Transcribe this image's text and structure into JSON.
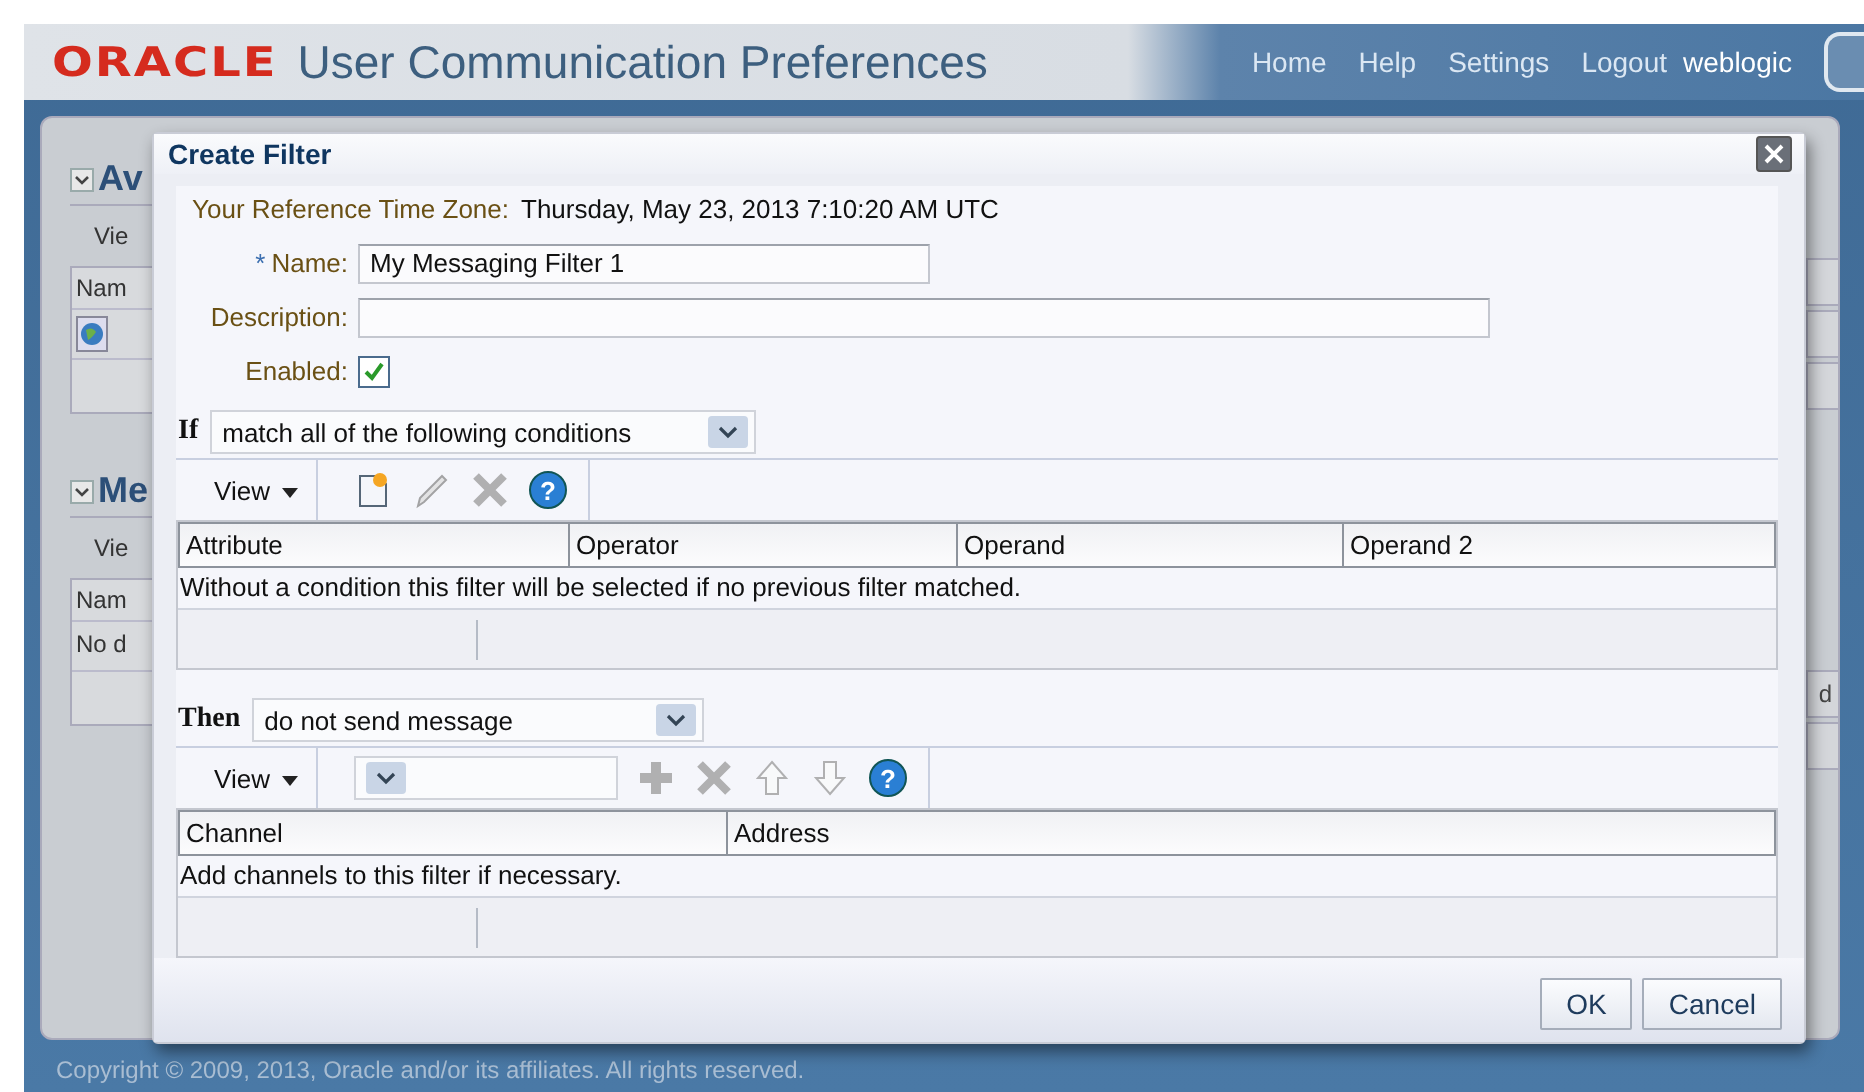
{
  "header": {
    "logo": "ORACLE",
    "title": "User Communication Preferences",
    "nav": [
      "Home",
      "Help",
      "Settings",
      "Logout"
    ],
    "user": "weblogic"
  },
  "background": {
    "sections": [
      {
        "title": "Av",
        "view": "Vie",
        "column": "Nam",
        "rows": [
          {
            "kind": "icon"
          }
        ]
      },
      {
        "title": "Me",
        "view": "Vie",
        "column": "Nam",
        "rows": [
          {
            "kind": "text",
            "text": "No d"
          }
        ]
      }
    ],
    "right_fragment": "d"
  },
  "dialog": {
    "title": "Create Filter",
    "timezone_label": "Your Reference Time Zone:",
    "timezone": "Thursday, May 23, 2013 7:10:20 AM UTC",
    "name": {
      "required_mark": "*",
      "label": "Name:",
      "value": "My Messaging Filter 1"
    },
    "description": {
      "label": "Description:"
    },
    "enabled": {
      "label": "Enabled:",
      "checked": true
    },
    "conditions": {
      "label": "If",
      "value": "match all of the following conditions",
      "view": "View",
      "tools": [
        {
          "kind": "new",
          "disabled": false
        },
        {
          "kind": "edit",
          "disabled": true
        },
        {
          "kind": "delete",
          "disabled": true
        },
        {
          "kind": "help",
          "disabled": false,
          "glyph": "?"
        }
      ],
      "columns": [
        "Attribute",
        "Operator",
        "Operand",
        "Operand 2"
      ],
      "empty_message": "Without a condition this filter will be selected if no previous filter matched."
    },
    "actions": {
      "label": "Then",
      "value": "do not send message",
      "view": "View",
      "tools": [
        {
          "kind": "select",
          "disabled": false
        },
        {
          "kind": "add",
          "disabled": true
        },
        {
          "kind": "delete",
          "disabled": true
        },
        {
          "kind": "up",
          "disabled": true
        },
        {
          "kind": "down",
          "disabled": true
        },
        {
          "kind": "help",
          "disabled": false,
          "glyph": "?"
        }
      ],
      "columns": [
        "Channel",
        "Address"
      ],
      "empty_message": "Add channels to this filter if necessary."
    },
    "buttons": [
      "OK",
      "Cancel"
    ]
  },
  "footer": "Copyright © 2009, 2013, Oracle and/or its affiliates. All rights reserved."
}
